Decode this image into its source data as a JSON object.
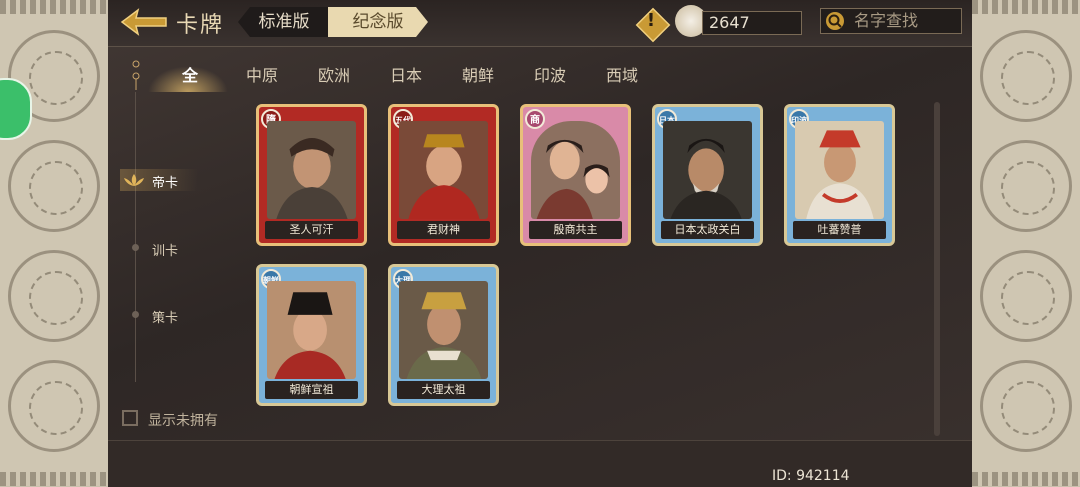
{
  "header": {
    "title": "卡牌",
    "versions": {
      "standard": "标准版",
      "commemorative": "纪念版"
    },
    "currency": "2647",
    "search_placeholder": "名字查找"
  },
  "tabs": [
    "全",
    "中原",
    "欧洲",
    "日本",
    "朝鲜",
    "印波",
    "西域"
  ],
  "categories": [
    "帝卡",
    "训卡",
    "策卡"
  ],
  "cards": [
    {
      "name": "圣人可汗",
      "badge": "隋",
      "frame": "red"
    },
    {
      "name": "君财神",
      "badge": "五代",
      "frame": "red"
    },
    {
      "name": "殷商共主",
      "badge": "商",
      "frame": "pink"
    },
    {
      "name": "日本太政关白",
      "badge": "日本",
      "frame": "blue"
    },
    {
      "name": "吐蕃赞普",
      "badge": "印波",
      "frame": "blue"
    },
    {
      "name": "朝鲜宣祖",
      "badge": "朝鲜",
      "frame": "blue"
    },
    {
      "name": "大理太祖",
      "badge": "大理",
      "frame": "blue"
    }
  ],
  "show_unowned_label": "显示未拥有",
  "user_id": "ID: 942114",
  "colors": {
    "red_frame": "#b22a24",
    "pink_frame": "#d98aa8",
    "blue_frame": "#7bb2d9",
    "gold": "#e8c07a"
  }
}
